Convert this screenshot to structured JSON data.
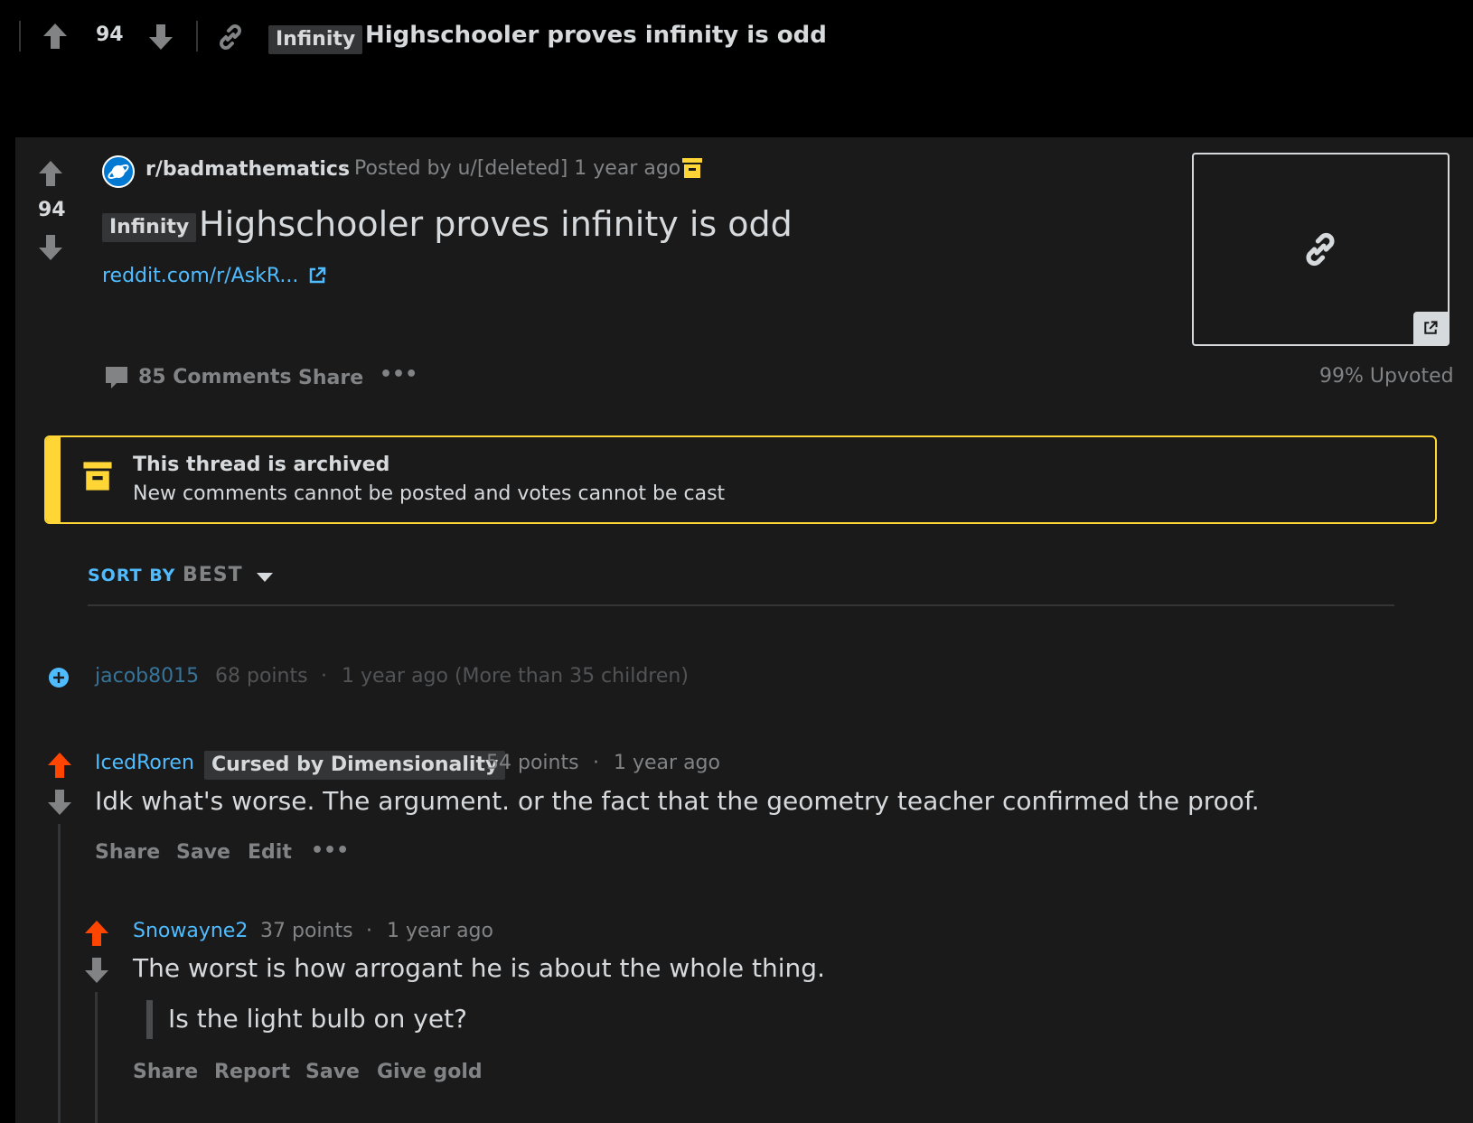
{
  "topbar": {
    "score": "94",
    "flair": "Infinity",
    "title": "Highschooler proves infinity is odd"
  },
  "post": {
    "score": "94",
    "subreddit": "r/badmathematics",
    "meta": "· Posted by u/[deleted] 1 year ago",
    "flair": "Infinity",
    "title": "Highschooler proves infinity is odd",
    "link_text": "reddit.com/r/AskR...",
    "comments_label": "85 Comments",
    "share_label": "Share",
    "more_label": "•••",
    "upvoted": "99% Upvoted"
  },
  "archive": {
    "title": "This thread is archived",
    "subtitle": "New comments cannot be posted and votes cannot be cast"
  },
  "sort": {
    "label": "SORT BY",
    "value": "BEST"
  },
  "comments": [
    {
      "user": "jacob8015",
      "points": "68 points",
      "dot": "·",
      "time": "1 year ago (More than 35 children)"
    },
    {
      "user": "IcedRoren",
      "flair": "Cursed by Dimensionality",
      "points": "54 points",
      "dot": "·",
      "time": "1 year ago",
      "text": "Idk what's worse. The argument. or the fact that the geometry teacher confirmed the proof.",
      "actions": [
        "Share",
        "Save",
        "Edit",
        "•••"
      ]
    },
    {
      "user": "Snowayne2",
      "points": "37 points",
      "dot": "·",
      "time": "1 year ago",
      "text": "The worst is how arrogant he is about the whole thing.",
      "quote": "Is the light bulb on yet?",
      "actions": [
        "Share",
        "Report",
        "Save",
        "Give gold"
      ]
    }
  ],
  "colors": {
    "background": "#000000",
    "card": "#1a1a1b",
    "text": "#d7dadc",
    "muted": "#818384",
    "link": "#4fbcff",
    "archive": "#ffd635",
    "upvote_active": "#ff4500"
  }
}
